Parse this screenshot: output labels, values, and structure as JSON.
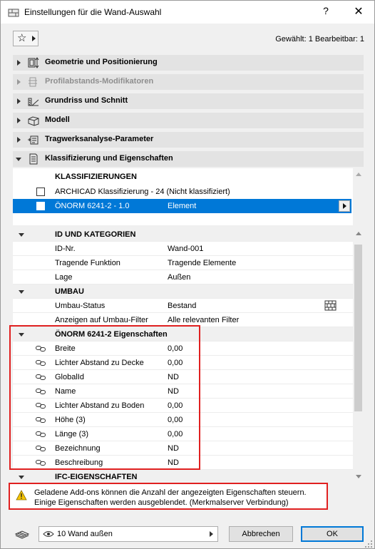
{
  "window": {
    "title": "Einstellungen für die Wand-Auswahl",
    "help_label": "?",
    "close_label": "✕"
  },
  "toolbar": {
    "favorites_icon": "star-icon",
    "selected_info": "Gewählt: 1 Bearbeitbar: 1"
  },
  "sections": [
    {
      "label": "Geometrie und Positionierung",
      "icon": "geometry-icon",
      "expanded": false,
      "disabled": false
    },
    {
      "label": "Profilabstands-Modifikatoren",
      "icon": "profile-modifier-icon",
      "expanded": false,
      "disabled": true
    },
    {
      "label": "Grundriss und Schnitt",
      "icon": "floorplan-section-icon",
      "expanded": false,
      "disabled": false
    },
    {
      "label": "Modell",
      "icon": "model-icon",
      "expanded": false,
      "disabled": false
    },
    {
      "label": "Tragwerksanalyse-Parameter",
      "icon": "structural-analysis-icon",
      "expanded": false,
      "disabled": false
    },
    {
      "label": "Klassifizierung und Eigenschaften",
      "icon": "classification-icon",
      "expanded": true,
      "disabled": false
    }
  ],
  "classification": {
    "header": "KLASSIFIZIERUNGEN",
    "rows": [
      {
        "system": "ARCHICAD Klassifizierung - 24 (Nicht klassifiziert)",
        "value": "",
        "checked": false,
        "selected": false
      },
      {
        "system": "ÖNORM 6241-2 - 1.0",
        "value": "Element",
        "checked": true,
        "selected": true
      }
    ]
  },
  "properties": {
    "groups": [
      {
        "name": "ID UND KATEGORIEN",
        "rows": [
          {
            "name": "ID-Nr.",
            "value": "Wand-001"
          },
          {
            "name": "Tragende Funktion",
            "value": "Tragende Elemente"
          },
          {
            "name": "Lage",
            "value": "Außen"
          }
        ]
      },
      {
        "name": "UMBAU",
        "rows": [
          {
            "name": "Umbau-Status",
            "value": "Bestand"
          },
          {
            "name": "Anzeigen auf Umbau-Filter",
            "value": "Alle relevanten Filter"
          }
        ]
      },
      {
        "name": "ÖNORM 6241-2 Eigenschaften",
        "rows": [
          {
            "name": "Breite",
            "value": "0,00"
          },
          {
            "name": "Lichter Abstand zu Decke",
            "value": "0,00"
          },
          {
            "name": "GlobalId",
            "value": "ND"
          },
          {
            "name": "Name",
            "value": "ND"
          },
          {
            "name": "Lichter Abstand zu Boden",
            "value": "0,00"
          },
          {
            "name": "Höhe (3)",
            "value": "0,00"
          },
          {
            "name": "Länge (3)",
            "value": "0,00"
          },
          {
            "name": "Bezeichnung",
            "value": "ND"
          },
          {
            "name": "Beschreibung",
            "value": "ND"
          }
        ]
      },
      {
        "name": "IFC-EIGENSCHAFTEN",
        "rows": []
      }
    ]
  },
  "warning": {
    "line1": "Geladene Add-ons können die Anzahl der angezeigten Eigenschaften steuern.",
    "line2": "Einige Eigenschaften werden ausgeblendet. (Merkmalserver Verbindung)"
  },
  "footer": {
    "view_label": "10 Wand außen",
    "cancel_label": "Abbrechen",
    "ok_label": "OK"
  },
  "colors": {
    "selection": "#0078d7",
    "highlight_border": "#e02020",
    "warning_icon": "#f5c400"
  }
}
